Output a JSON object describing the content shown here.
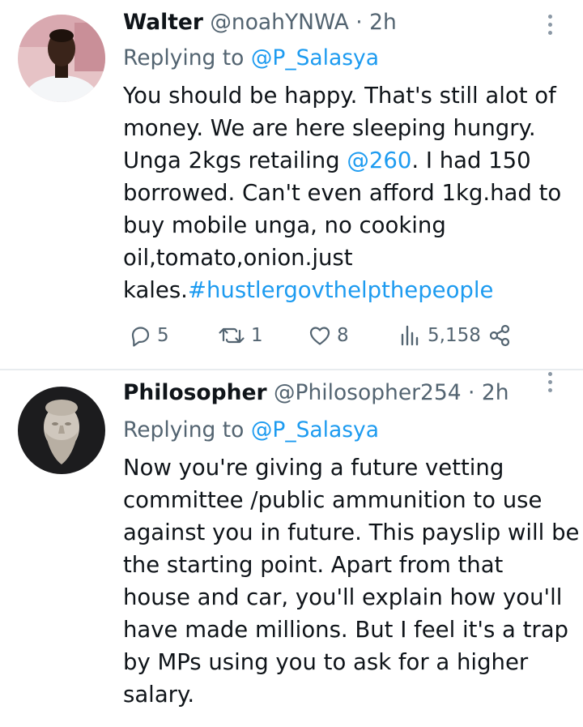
{
  "tweets": [
    {
      "name": "Walter",
      "handle": "@noahYNWA",
      "time": "· 2h",
      "replying_prefix": "Replying to",
      "replying_to": "@P_Salasya",
      "body_lines": [
        "You should be happy. That's still alot of",
        "money. We are here sleeping hungry.",
        "Unga 2kgs retailing ",
        "borrowed. Can't even afford 1kg.had to",
        "buy mobile unga, no cooking",
        "oil,tomato,onion.just",
        "kales."
      ],
      "line3_mention": "@260",
      "line3_tail": ". I had 150",
      "hashtag": "#hustlergovthelpthepeople",
      "replies": "5",
      "retweets": "1",
      "likes": "8",
      "views": "5,158"
    },
    {
      "name": "Philosopher",
      "handle": "@Philosopher254",
      "time": "· 2h",
      "replying_prefix": "Replying to",
      "replying_to": "@P_Salasya",
      "body_lines": [
        "Now you're giving a future vetting",
        "committee /public ammunition to use",
        "against you in future. This payslip will be",
        "the starting point. Apart from that",
        "house and car, you'll explain how you'll",
        "have made millions.  But I feel it's a trap",
        "by MPs using you to ask for a higher",
        "salary."
      ]
    }
  ],
  "colors": {
    "text": "#0f1419",
    "secondary": "#536471",
    "link": "#1d9bf0",
    "divider": "#e8ecef"
  },
  "icons": [
    "reply-icon",
    "retweet-icon",
    "like-icon",
    "views-icon",
    "share-icon",
    "more-icon"
  ]
}
